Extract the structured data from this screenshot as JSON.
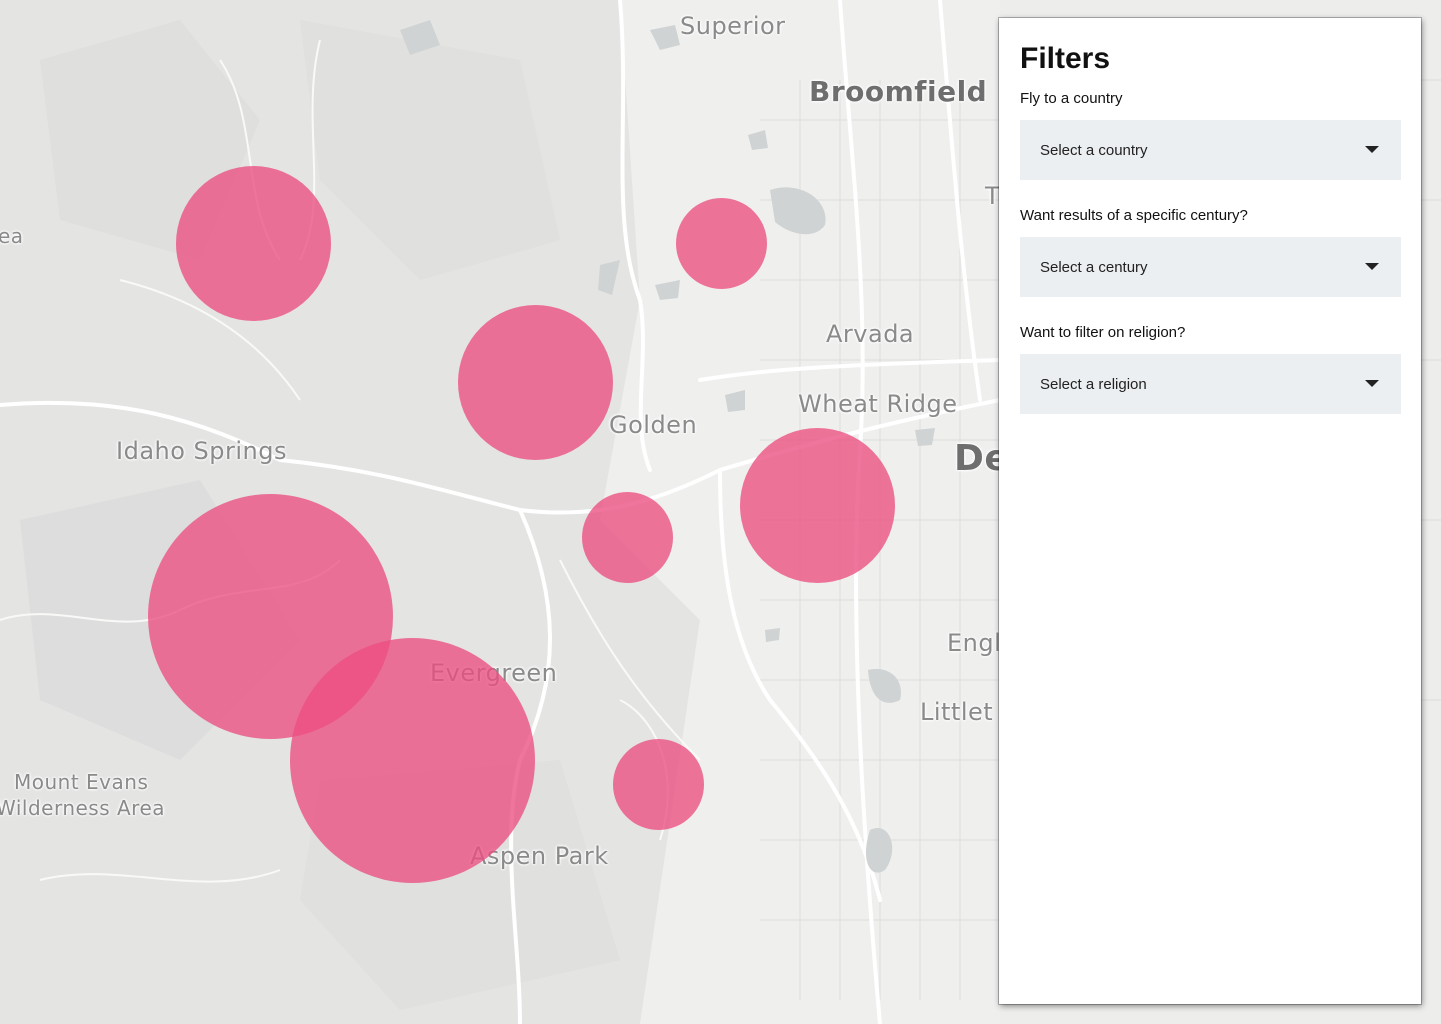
{
  "map": {
    "places": [
      {
        "name": "Superior",
        "size": "med"
      },
      {
        "name": "Broomfield",
        "size": "big"
      },
      {
        "name": "Arvada",
        "size": "med"
      },
      {
        "name": "Wheat Ridge",
        "size": "med"
      },
      {
        "name": "Golden",
        "size": "med"
      },
      {
        "name": "Idaho Springs",
        "size": "med"
      },
      {
        "name": "Evergreen",
        "size": "med"
      },
      {
        "name": "Aspen Park",
        "size": "med"
      },
      {
        "name": "Mount Evans",
        "size": "small"
      },
      {
        "name": "Wilderness Area",
        "size": "small"
      },
      {
        "name": "Engl",
        "size": "med"
      },
      {
        "name": "Littlet",
        "size": "med"
      },
      {
        "name": "De",
        "size": "big"
      },
      {
        "name": "ea",
        "size": "small"
      },
      {
        "name": "T",
        "size": "med"
      }
    ],
    "marker_color": "#ec4e80",
    "marker_count": 8
  },
  "filters": {
    "title": "Filters",
    "country": {
      "label": "Fly to a country",
      "selected": "Select a country"
    },
    "century": {
      "label": "Want results of a specific century?",
      "selected": "Select a century"
    },
    "religion": {
      "label": "Want to filter on religion?",
      "selected": "Select a religion"
    }
  }
}
